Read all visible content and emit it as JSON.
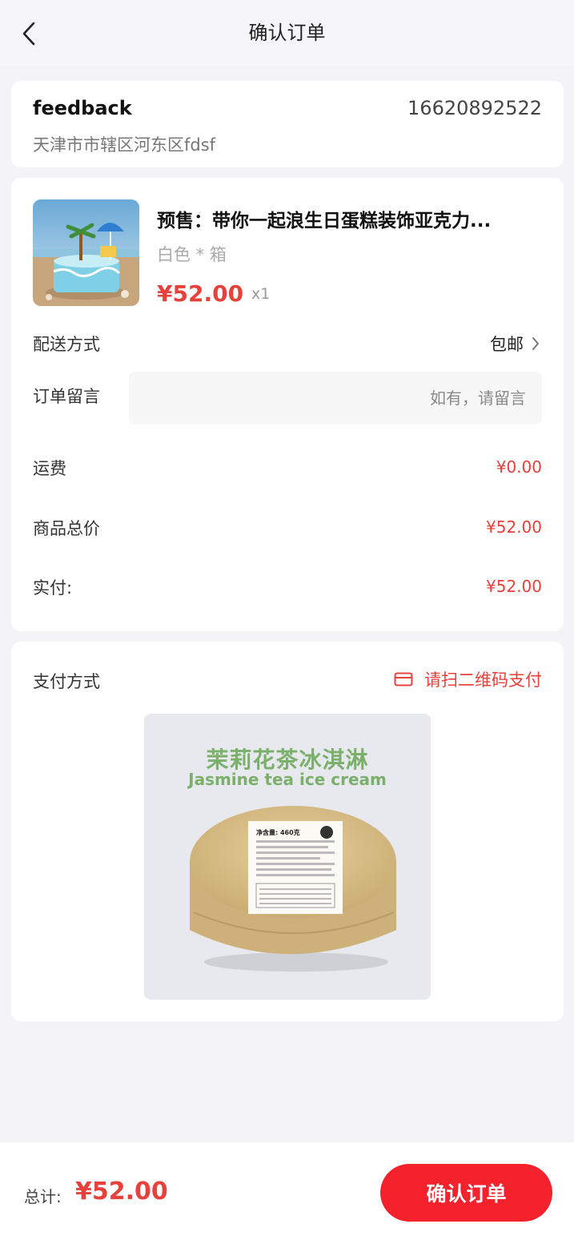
{
  "header": {
    "title": "确认订单",
    "back_icon": "chevron-left-icon"
  },
  "address": {
    "name": "feedback",
    "phone": "16620892522",
    "detail": "天津市市辖区河东区fdsf"
  },
  "product": {
    "title": "预售：带你一起浪生日蛋糕装饰亚克力...",
    "spec": "白色 * 箱",
    "price": "¥52.00",
    "quantity": "x1",
    "image": "cake-thumbnail"
  },
  "delivery": {
    "label": "配送方式",
    "value": "包邮"
  },
  "note": {
    "label": "订单留言",
    "placeholder": "如有，请留言",
    "value": ""
  },
  "fees": {
    "shipping_label": "运费",
    "shipping_value": "¥0.00",
    "goods_total_label": "商品总价",
    "goods_total_value": "¥52.00",
    "paid_label": "实付:",
    "paid_value": "¥52.00"
  },
  "payment": {
    "label": "支付方式",
    "method": "请扫二维码支付",
    "method_icon": "card-icon",
    "qr_image_title_cn": "茉莉花茶冰淇淋",
    "qr_image_title_en": "Jasmine tea ice cream",
    "qr_image_label_net": "净含量: 460克"
  },
  "footer": {
    "total_label": "总计:",
    "total_value": "¥52.00",
    "confirm_label": "确认订单"
  },
  "colors": {
    "accent": "#e8403a",
    "button": "#f5222d",
    "background": "#f4f4f6"
  }
}
